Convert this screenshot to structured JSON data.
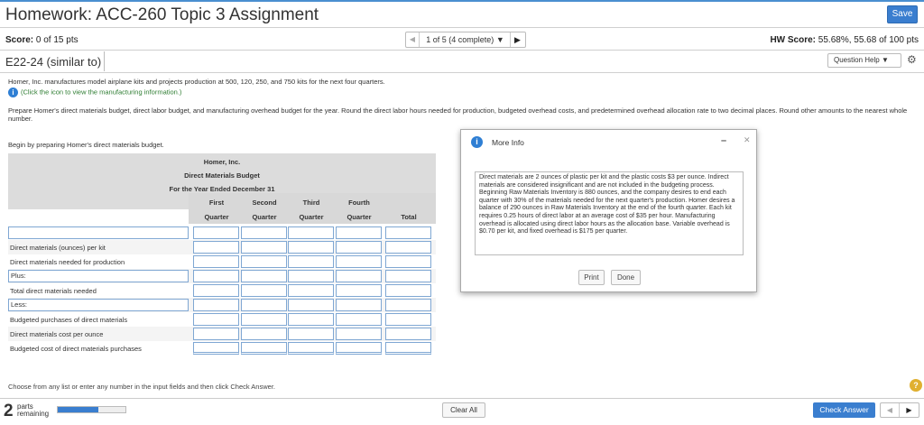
{
  "header": {
    "title": "Homework: ACC-260 Topic 3 Assignment",
    "save_label": "Save",
    "score_label": "Score:",
    "score_value": "0 of 15 pts",
    "nav_text": "1 of 5 (4 complete)",
    "hw_score_label": "HW Score:",
    "hw_score_value": "55.68%, 55.68 of 100 pts"
  },
  "exercise": {
    "id": "E22-24 (similar to)",
    "help_label": "Question Help"
  },
  "problem": {
    "intro": "Homer, Inc. manufactures model airplane kits and projects production at 500, 120, 250, and 750 kits for the next four quarters.",
    "click_link": "(Click the icon to view the manufacturing information.)",
    "instructions": "Prepare Homer's direct materials budget, direct labor budget, and manufacturing overhead budget for the year. Round the direct labor hours needed for production, budgeted overhead costs, and predetermined overhead allocation rate to two decimal places. Round other amounts to the nearest whole number.",
    "begin": "Begin by preparing Homer's direct materials budget."
  },
  "budget": {
    "company": "Homer, Inc.",
    "name": "Direct Materials Budget",
    "period": "For the Year Ended December 31",
    "columns": [
      {
        "top": "First",
        "bottom": "Quarter"
      },
      {
        "top": "Second",
        "bottom": "Quarter"
      },
      {
        "top": "Third",
        "bottom": "Quarter"
      },
      {
        "top": "Fourth",
        "bottom": "Quarter"
      },
      {
        "top": "",
        "bottom": "Total"
      }
    ],
    "rows": [
      {
        "label": ""
      },
      {
        "label": "Direct materials (ounces) per kit"
      },
      {
        "label": "Direct materials needed for production"
      },
      {
        "label": "Plus:"
      },
      {
        "label": "Total direct materials needed"
      },
      {
        "label": "Less:"
      },
      {
        "label": "Budgeted purchases of direct materials"
      },
      {
        "label": "Direct materials cost per ounce"
      },
      {
        "label": "Budgeted cost of direct materials purchases"
      }
    ]
  },
  "modal": {
    "title": "More Info",
    "text": "Direct materials are 2 ounces of plastic per kit and the plastic costs $3 per ounce. Indirect materials are considered insignificant and are not included in the budgeting process. Beginning Raw Materials Inventory is 880 ounces, and the company desires to end each quarter with 30% of the materials needed for the next quarter's production. Homer desires a balance of 290 ounces in Raw Materials Inventory at the end of the fourth quarter. Each kit requires 0.25 hours of direct labor at an average cost of $35 per hour. Manufacturing overhead is allocated using direct labor hours as the allocation base. Variable overhead is $0.70 per kit, and fixed overhead is $175 per quarter.",
    "print_label": "Print",
    "done_label": "Done"
  },
  "footer": {
    "choose_text": "Choose from any list or enter any number in the input fields and then click Check Answer.",
    "parts_number": "2",
    "parts_label_1": "parts",
    "parts_label_2": "remaining",
    "progress_fraction": 0.6,
    "clear_label": "Clear All",
    "check_label": "Check Answer"
  },
  "colors": {
    "accent": "#3a7ecf",
    "info": "#2f7fd4",
    "link_green": "#2e7d32"
  }
}
